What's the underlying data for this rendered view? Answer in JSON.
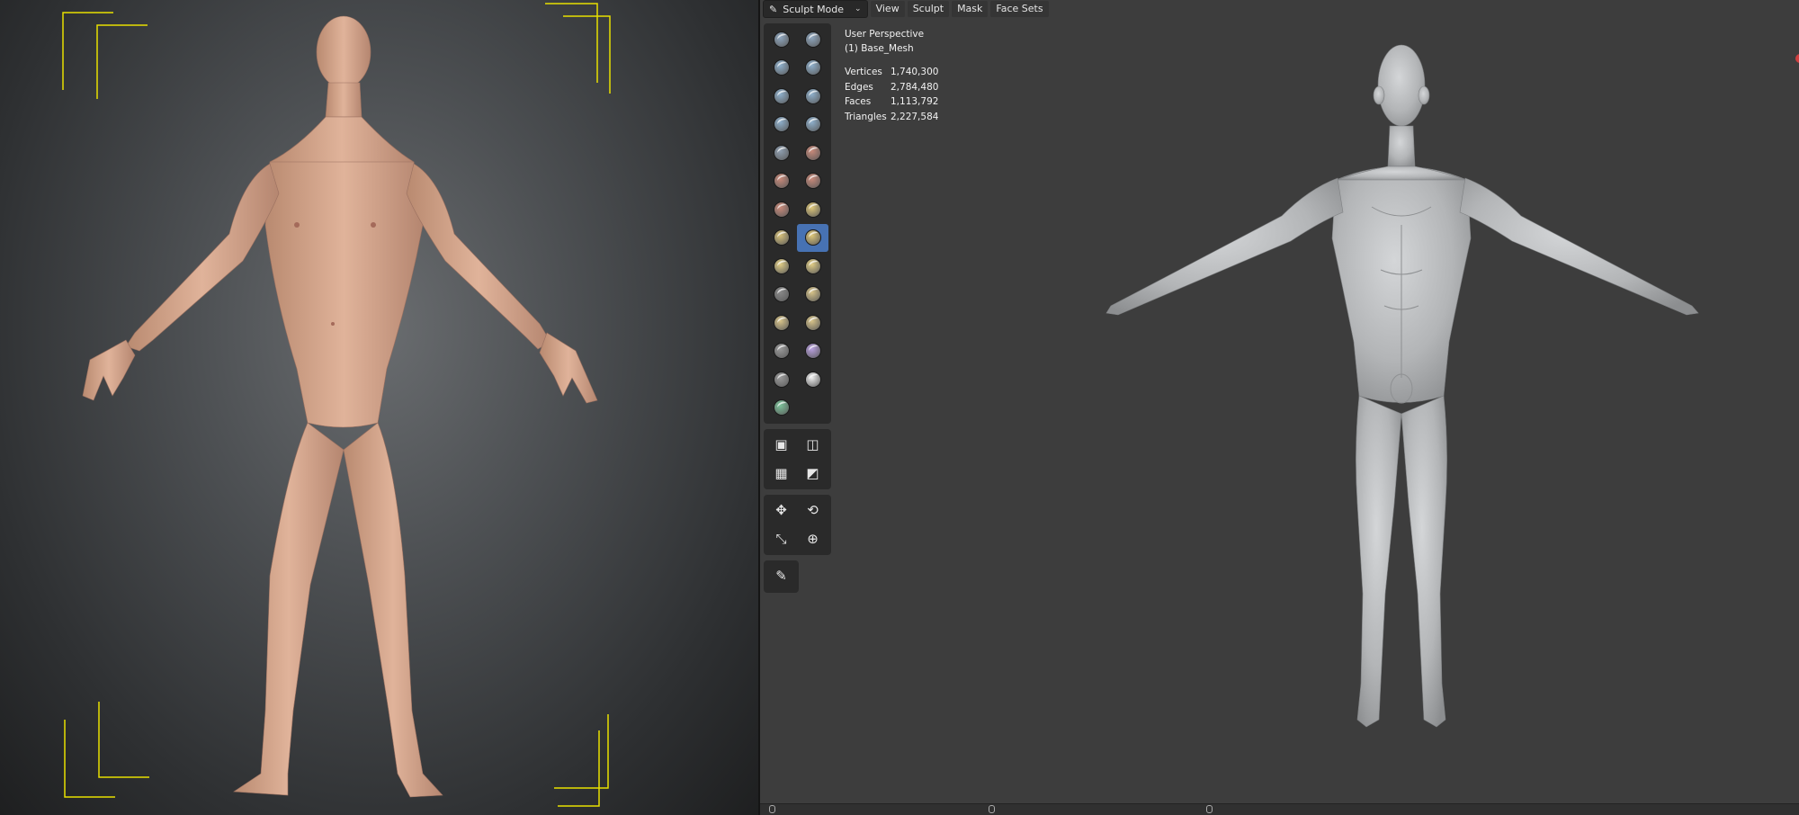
{
  "header": {
    "mode_label": "Sculpt Mode",
    "menus": [
      "View",
      "Sculpt",
      "Mask",
      "Face Sets"
    ]
  },
  "viewport": {
    "perspective": "User Perspective",
    "object": "(1) Base_Mesh"
  },
  "stats": [
    {
      "label": "Vertices",
      "value": "1,740,300"
    },
    {
      "label": "Edges",
      "value": "2,784,480"
    },
    {
      "label": "Faces",
      "value": "1,113,792"
    },
    {
      "label": "Triangles",
      "value": "2,227,584"
    }
  ],
  "colors": {
    "active_tool": "#4772b3",
    "frame_guides": "#e8e000",
    "skin": "#d9a88c",
    "clay": "#b9bbbd"
  },
  "toolbar": {
    "brush_tools": [
      {
        "name": "draw-brush-icon",
        "color": "#8fa7bf"
      },
      {
        "name": "draw-sharp-brush-icon",
        "color": "#8fa7bf"
      },
      {
        "name": "clay-brush-icon",
        "color": "#8fb0cc"
      },
      {
        "name": "clay-strips-brush-icon",
        "color": "#8fb0cc"
      },
      {
        "name": "clay-thumb-brush-icon",
        "color": "#8fb0cc"
      },
      {
        "name": "layer-brush-icon",
        "color": "#8fb0cc"
      },
      {
        "name": "inflate-brush-icon",
        "color": "#8fb0cc"
      },
      {
        "name": "blob-brush-icon",
        "color": "#8fb0cc"
      },
      {
        "name": "crease-brush-icon",
        "color": "#8f9fb0"
      },
      {
        "name": "smooth-brush-icon",
        "color": "#c98a7a"
      },
      {
        "name": "flatten-brush-icon",
        "color": "#c98a7a"
      },
      {
        "name": "fill-brush-icon",
        "color": "#c98a7a"
      },
      {
        "name": "scrape-brush-icon",
        "color": "#c98a7a"
      },
      {
        "name": "multiplane-scrape-brush-icon",
        "color": "#e0c879"
      },
      {
        "name": "pinch-brush-icon",
        "color": "#d8c27a"
      },
      {
        "name": "grab-brush-icon",
        "color": "#e0c879",
        "active": true
      },
      {
        "name": "elastic-deform-brush-icon",
        "color": "#e3cf86"
      },
      {
        "name": "snake-hook-brush-icon",
        "color": "#e3cf86"
      },
      {
        "name": "thumb-brush-icon",
        "color": "#8a8a8a"
      },
      {
        "name": "pose-brush-icon",
        "color": "#d9c58a"
      },
      {
        "name": "nudge-brush-icon",
        "color": "#d9c58a"
      },
      {
        "name": "rotate-brush-icon",
        "color": "#d9c58a"
      },
      {
        "name": "slide-relax-brush-icon",
        "color": "#9a9a9a"
      },
      {
        "name": "boundary-brush-icon",
        "color": "#b9a0e0"
      },
      {
        "name": "cloth-brush-icon",
        "color": "#9a9a9a"
      },
      {
        "name": "simplify-brush-icon",
        "color": "#f0f0f0"
      },
      {
        "name": "mask-brush-icon",
        "color": "#7cc39a"
      }
    ],
    "box_tools": [
      {
        "name": "box-mask-icon",
        "glyph": "▣"
      },
      {
        "name": "box-hide-icon",
        "glyph": "◫"
      },
      {
        "name": "box-face-set-icon",
        "glyph": "▦"
      },
      {
        "name": "box-trim-icon",
        "glyph": "◩"
      }
    ],
    "transform_tools": [
      {
        "name": "move-icon",
        "glyph": "✥"
      },
      {
        "name": "rotate-icon",
        "glyph": "⟲"
      },
      {
        "name": "scale-icon",
        "glyph": "⤡"
      },
      {
        "name": "transform-icon",
        "glyph": "⊕"
      }
    ],
    "annotate_tools": [
      {
        "name": "annotate-icon",
        "glyph": "✎"
      }
    ]
  }
}
